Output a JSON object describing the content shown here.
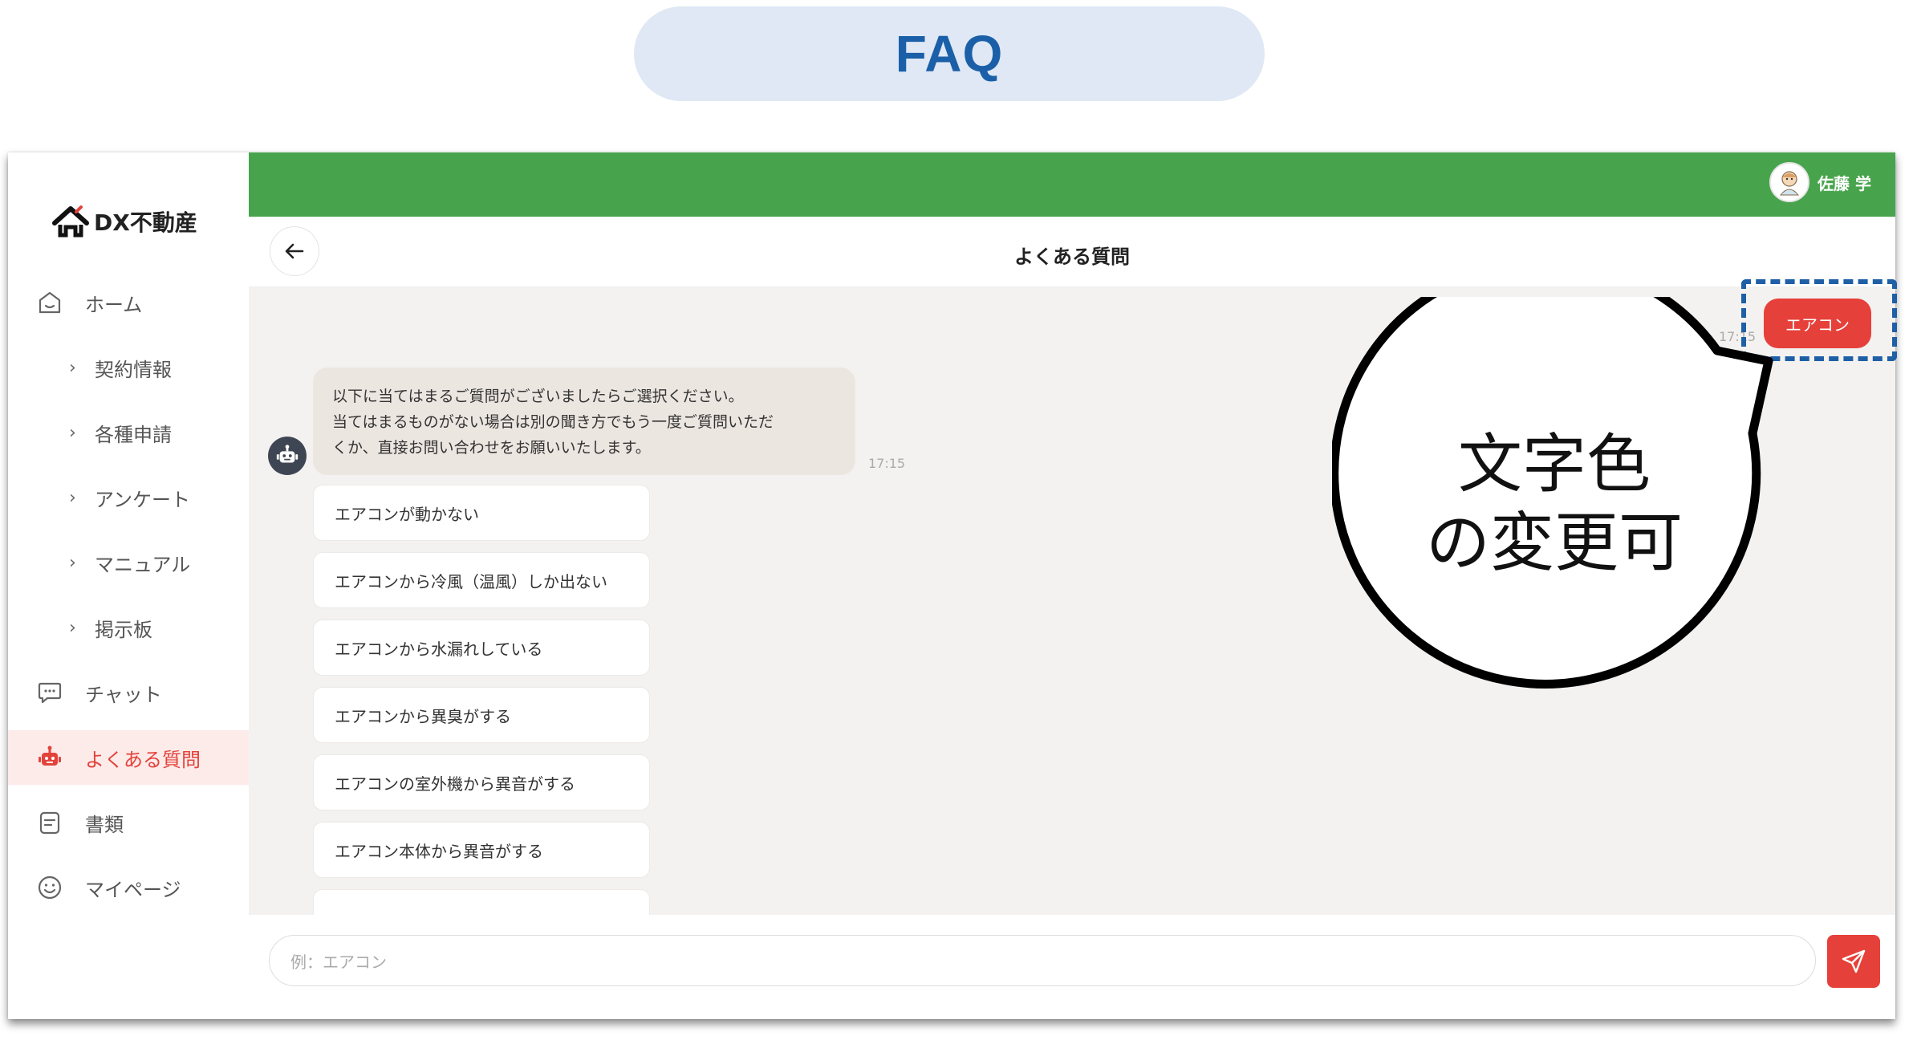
{
  "header_pill": {
    "label": "FAQ"
  },
  "brand": {
    "name": "DX不動産"
  },
  "sidebar": {
    "items": [
      {
        "label": "ホーム",
        "icon": "home-icon",
        "type": "main"
      },
      {
        "label": "契約情報",
        "icon": "chevron-right-icon",
        "type": "sub"
      },
      {
        "label": "各種申請",
        "icon": "chevron-right-icon",
        "type": "sub"
      },
      {
        "label": "アンケート",
        "icon": "chevron-right-icon",
        "type": "sub"
      },
      {
        "label": "マニュアル",
        "icon": "chevron-right-icon",
        "type": "sub"
      },
      {
        "label": "掲示板",
        "icon": "chevron-right-icon",
        "type": "sub"
      },
      {
        "label": "チャット",
        "icon": "chat-bubble-icon",
        "type": "main"
      },
      {
        "label": "よくある質問",
        "icon": "robot-icon",
        "type": "main",
        "active": true
      },
      {
        "label": "書類",
        "icon": "document-icon",
        "type": "main"
      },
      {
        "label": "マイページ",
        "icon": "smiley-icon",
        "type": "main"
      }
    ]
  },
  "topbar": {
    "user_name": "佐藤 学",
    "color": "#48a44c"
  },
  "page": {
    "title": "よくある質問"
  },
  "chat": {
    "user_message": {
      "text": "エアコン",
      "time": "17:15"
    },
    "bot_message": {
      "lines": [
        "以下に当てはまるご質問がございましたらご選択ください。",
        "当てはまるものがない場合は別の聞き方でもう一度ご質問いただ",
        "くか、直接お問い合わせをお願いいたします。"
      ],
      "time": "17:15"
    },
    "options": [
      "エアコンが動かない",
      "エアコンから冷風（温風）しか出ない",
      "エアコンから水漏れしている",
      "エアコンから異臭がする",
      "エアコンの室外機から異音がする",
      "エアコン本体から異音がする"
    ]
  },
  "input": {
    "placeholder": "例：エアコン"
  },
  "annotation": {
    "line1": "文字色",
    "line2": "の変更可"
  },
  "colors": {
    "accent_red": "#e6403a",
    "active_bg": "#fdebea",
    "faq_pill_bg": "#dfe8f4",
    "faq_pill_text": "#1a5fa8",
    "dash_box": "#1e5fa6"
  }
}
